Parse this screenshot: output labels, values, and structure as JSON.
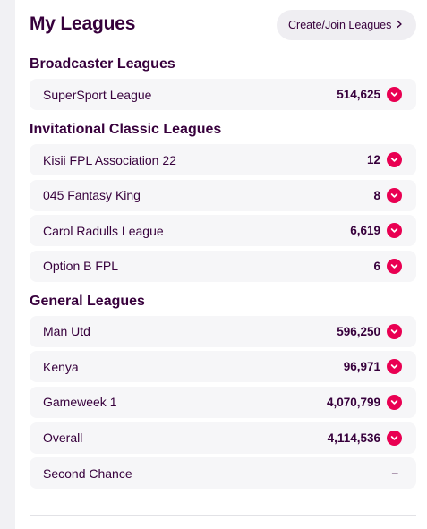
{
  "header": {
    "title": "My Leagues",
    "create_join_label": "Create/Join Leagues"
  },
  "sections": [
    {
      "title": "Broadcaster Leagues",
      "leagues": [
        {
          "name": "SuperSport League",
          "rank": "514,625",
          "expandable": true
        }
      ]
    },
    {
      "title": "Invitational Classic Leagues",
      "leagues": [
        {
          "name": "Kisii FPL Association 22",
          "rank": "12",
          "expandable": true
        },
        {
          "name": "045 Fantasy King",
          "rank": "8",
          "expandable": true
        },
        {
          "name": "Carol Radulls League",
          "rank": "6,619",
          "expandable": true
        },
        {
          "name": "Option B FPL",
          "rank": "6",
          "expandable": true
        }
      ]
    },
    {
      "title": "General Leagues",
      "leagues": [
        {
          "name": "Man Utd",
          "rank": "596,250",
          "expandable": true
        },
        {
          "name": "Kenya",
          "rank": "96,971",
          "expandable": true
        },
        {
          "name": "Gameweek 1",
          "rank": "4,070,799",
          "expandable": true
        },
        {
          "name": "Overall",
          "rank": "4,114,536",
          "expandable": true
        },
        {
          "name": "Second Chance",
          "rank": "–",
          "expandable": false
        }
      ]
    }
  ],
  "icons": {
    "toggle": "chevron-down-icon",
    "button": "chevron-right-icon"
  },
  "colors": {
    "primary": "#37003c",
    "accent": "#e90052",
    "row_bg": "#f6f6f8",
    "button_bg": "#efeef2"
  }
}
